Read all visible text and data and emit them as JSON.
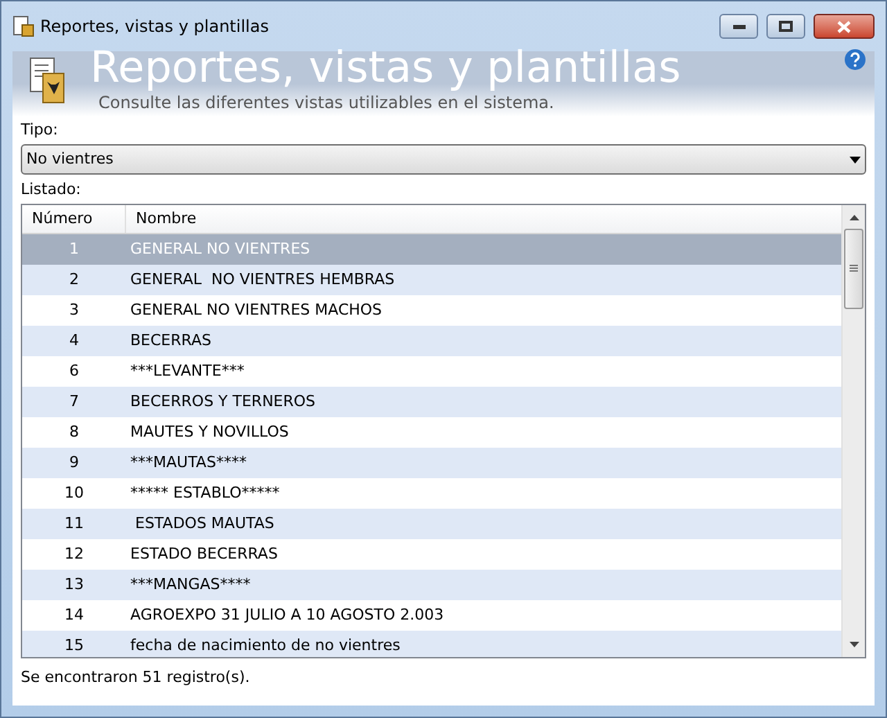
{
  "window": {
    "title": "Reportes, vistas y plantillas"
  },
  "header": {
    "title": "Reportes, vistas y plantillas",
    "subtitle": "Consulte las diferentes vistas utilizables en el sistema."
  },
  "tipo": {
    "label": "Tipo:",
    "value": "No vientres"
  },
  "listado": {
    "label": "Listado:",
    "columns": [
      "Número",
      "Nombre"
    ],
    "rows": [
      {
        "numero": "1",
        "nombre": "GENERAL NO VIENTRES",
        "selected": true
      },
      {
        "numero": "2",
        "nombre": "GENERAL  NO VIENTRES HEMBRAS",
        "selected": false
      },
      {
        "numero": "3",
        "nombre": "GENERAL NO VIENTRES MACHOS",
        "selected": false
      },
      {
        "numero": "4",
        "nombre": "BECERRAS",
        "selected": false
      },
      {
        "numero": "6",
        "nombre": "***LEVANTE***",
        "selected": false
      },
      {
        "numero": "7",
        "nombre": "BECERROS Y TERNEROS",
        "selected": false
      },
      {
        "numero": "8",
        "nombre": "MAUTES Y NOVILLOS",
        "selected": false
      },
      {
        "numero": "9",
        "nombre": "***MAUTAS****",
        "selected": false
      },
      {
        "numero": "10",
        "nombre": "***** ESTABLO*****",
        "selected": false
      },
      {
        "numero": "11",
        "nombre": " ESTADOS MAUTAS",
        "selected": false
      },
      {
        "numero": "12",
        "nombre": "ESTADO BECERRAS",
        "selected": false
      },
      {
        "numero": "13",
        "nombre": "***MANGAS****",
        "selected": false
      },
      {
        "numero": "14",
        "nombre": "AGROEXPO 31 JULIO A 10 AGOSTO 2.003",
        "selected": false
      },
      {
        "numero": "15",
        "nombre": "fecha de nacimiento de no vientres",
        "selected": false
      }
    ]
  },
  "status": "Se encontraron 51 registro(s)."
}
